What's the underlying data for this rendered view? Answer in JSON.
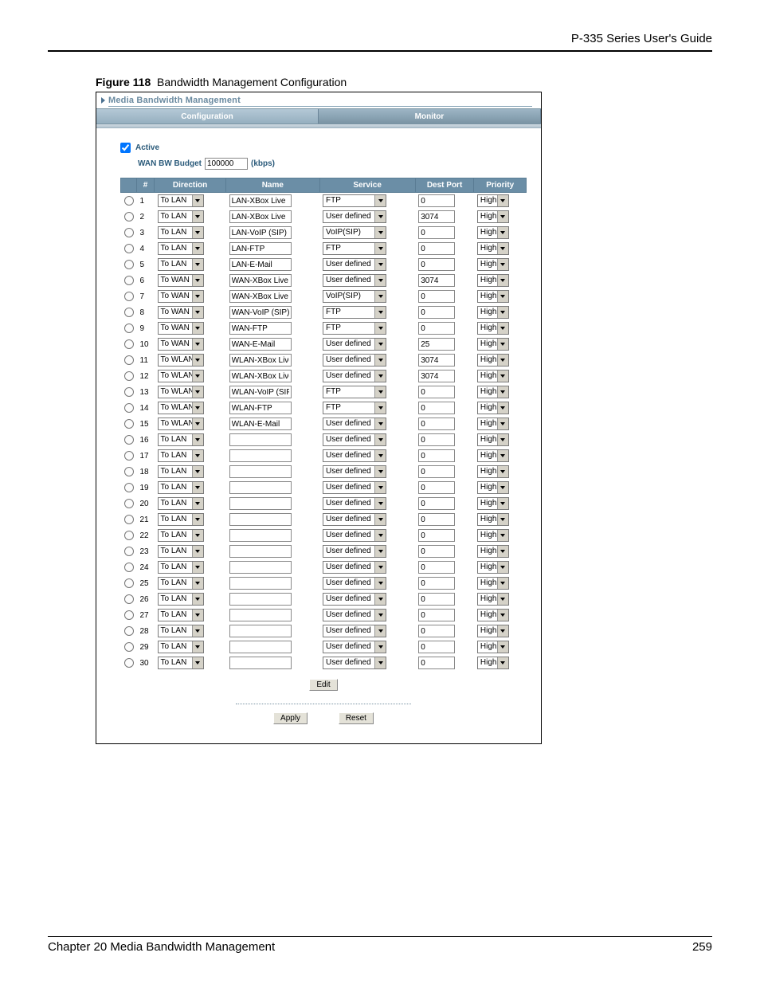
{
  "document": {
    "header_right": "P-335 Series User's Guide",
    "figure_label": "Figure 118",
    "figure_title": "Bandwidth Management Configuration",
    "footer_left": "Chapter 20 Media Bandwidth Management",
    "footer_right": "259"
  },
  "window": {
    "title": "Media Bandwidth Management",
    "tab_config": "Configuration",
    "tab_monitor": "Monitor"
  },
  "form": {
    "active_label": "Active",
    "budget_label": "WAN BW Budget",
    "budget_value": "100000",
    "budget_unit": "(kbps)",
    "headers": {
      "num": "#",
      "direction": "Direction",
      "name": "Name",
      "service": "Service",
      "dest_port": "Dest Port",
      "priority": "Priority"
    },
    "edit_btn": "Edit",
    "apply_btn": "Apply",
    "reset_btn": "Reset"
  },
  "rows": [
    {
      "n": "1",
      "dir": "To LAN",
      "name": "LAN-XBox Live",
      "svc": "FTP",
      "port": "0",
      "pri": "High"
    },
    {
      "n": "2",
      "dir": "To LAN",
      "name": "LAN-XBox Live",
      "svc": "User defined",
      "port": "3074",
      "pri": "High"
    },
    {
      "n": "3",
      "dir": "To LAN",
      "name": "LAN-VoIP (SIP)",
      "svc": "VoIP(SIP)",
      "port": "0",
      "pri": "High"
    },
    {
      "n": "4",
      "dir": "To LAN",
      "name": "LAN-FTP",
      "svc": "FTP",
      "port": "0",
      "pri": "High"
    },
    {
      "n": "5",
      "dir": "To LAN",
      "name": "LAN-E-Mail",
      "svc": "User defined",
      "port": "0",
      "pri": "High"
    },
    {
      "n": "6",
      "dir": "To WAN",
      "name": "WAN-XBox Live",
      "svc": "User defined",
      "port": "3074",
      "pri": "High"
    },
    {
      "n": "7",
      "dir": "To WAN",
      "name": "WAN-XBox Live",
      "svc": "VoIP(SIP)",
      "port": "0",
      "pri": "High"
    },
    {
      "n": "8",
      "dir": "To WAN",
      "name": "WAN-VoIP (SIP)",
      "svc": "FTP",
      "port": "0",
      "pri": "High"
    },
    {
      "n": "9",
      "dir": "To WAN",
      "name": "WAN-FTP",
      "svc": "FTP",
      "port": "0",
      "pri": "High"
    },
    {
      "n": "10",
      "dir": "To WAN",
      "name": "WAN-E-Mail",
      "svc": "User defined",
      "port": "25",
      "pri": "High"
    },
    {
      "n": "11",
      "dir": "To WLAN",
      "name": "WLAN-XBox Live",
      "svc": "User defined",
      "port": "3074",
      "pri": "High"
    },
    {
      "n": "12",
      "dir": "To WLAN",
      "name": "WLAN-XBox Live",
      "svc": "User defined",
      "port": "3074",
      "pri": "High"
    },
    {
      "n": "13",
      "dir": "To WLAN",
      "name": "WLAN-VoIP (SIP",
      "svc": "FTP",
      "port": "0",
      "pri": "High"
    },
    {
      "n": "14",
      "dir": "To WLAN",
      "name": "WLAN-FTP",
      "svc": "FTP",
      "port": "0",
      "pri": "High"
    },
    {
      "n": "15",
      "dir": "To WLAN",
      "name": "WLAN-E-Mail",
      "svc": "User defined",
      "port": "0",
      "pri": "High"
    },
    {
      "n": "16",
      "dir": "To LAN",
      "name": "",
      "svc": "User defined",
      "port": "0",
      "pri": "High"
    },
    {
      "n": "17",
      "dir": "To LAN",
      "name": "",
      "svc": "User defined",
      "port": "0",
      "pri": "High"
    },
    {
      "n": "18",
      "dir": "To LAN",
      "name": "",
      "svc": "User defined",
      "port": "0",
      "pri": "High"
    },
    {
      "n": "19",
      "dir": "To LAN",
      "name": "",
      "svc": "User defined",
      "port": "0",
      "pri": "High"
    },
    {
      "n": "20",
      "dir": "To LAN",
      "name": "",
      "svc": "User defined",
      "port": "0",
      "pri": "High"
    },
    {
      "n": "21",
      "dir": "To LAN",
      "name": "",
      "svc": "User defined",
      "port": "0",
      "pri": "High"
    },
    {
      "n": "22",
      "dir": "To LAN",
      "name": "",
      "svc": "User defined",
      "port": "0",
      "pri": "High"
    },
    {
      "n": "23",
      "dir": "To LAN",
      "name": "",
      "svc": "User defined",
      "port": "0",
      "pri": "High"
    },
    {
      "n": "24",
      "dir": "To LAN",
      "name": "",
      "svc": "User defined",
      "port": "0",
      "pri": "High"
    },
    {
      "n": "25",
      "dir": "To LAN",
      "name": "",
      "svc": "User defined",
      "port": "0",
      "pri": "High"
    },
    {
      "n": "26",
      "dir": "To LAN",
      "name": "",
      "svc": "User defined",
      "port": "0",
      "pri": "High"
    },
    {
      "n": "27",
      "dir": "To LAN",
      "name": "",
      "svc": "User defined",
      "port": "0",
      "pri": "High"
    },
    {
      "n": "28",
      "dir": "To LAN",
      "name": "",
      "svc": "User defined",
      "port": "0",
      "pri": "High"
    },
    {
      "n": "29",
      "dir": "To LAN",
      "name": "",
      "svc": "User defined",
      "port": "0",
      "pri": "High"
    },
    {
      "n": "30",
      "dir": "To LAN",
      "name": "",
      "svc": "User defined",
      "port": "0",
      "pri": "High"
    }
  ]
}
